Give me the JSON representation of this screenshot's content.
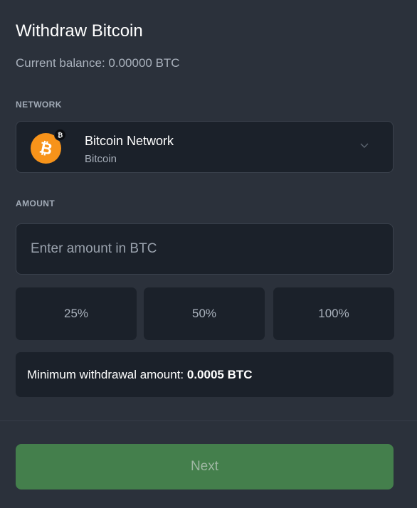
{
  "header": {
    "title": "Withdraw Bitcoin",
    "balance_text": "Current balance: 0.00000 BTC"
  },
  "network": {
    "section_label": "NETWORK",
    "selected_name": "Bitcoin Network",
    "selected_sub": "Bitcoin",
    "icon": "bitcoin-icon",
    "badge_icon": "bitcoin-badge-icon",
    "accent_color": "#f7931a"
  },
  "amount": {
    "section_label": "AMOUNT",
    "input_value": "",
    "placeholder": "Enter amount in BTC",
    "presets": [
      "25%",
      "50%",
      "100%"
    ]
  },
  "minimum": {
    "label": "Minimum withdrawal amount: ",
    "value": "0.0005 BTC"
  },
  "footer": {
    "next_label": "Next",
    "next_color": "#447f4c"
  }
}
